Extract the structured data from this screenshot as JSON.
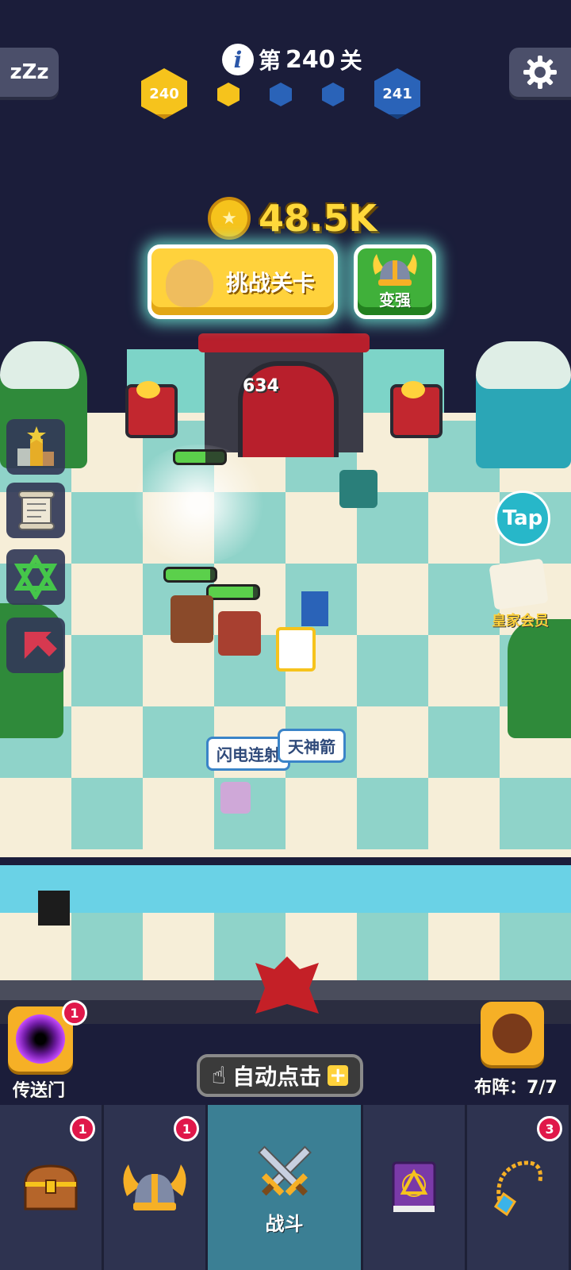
{
  "header": {
    "sleep_label": "zZz",
    "level_prefix": "第",
    "level_number": "240",
    "level_suffix": "关",
    "progress": {
      "current_level": "240",
      "next_level": "241",
      "current_color": "#f6c31c",
      "next_color": "#2a63b8"
    }
  },
  "coins": {
    "value": "48.5K",
    "icon": "coin-icon"
  },
  "actions": {
    "challenge_label": "挑战关卡",
    "upgrade_label": "变强"
  },
  "battle": {
    "damage_number": "634",
    "skill_labels": [
      "闪电连射",
      "天神箭"
    ],
    "enemy_hp": [
      0.62,
      0.9,
      0.9
    ]
  },
  "side_menu": {
    "items": [
      "trophy-icon",
      "scroll-icon",
      "hexagram-icon",
      "arrow-icon"
    ]
  },
  "right": {
    "tap_label": "Tap",
    "vip_label": "皇家会员"
  },
  "bottom": {
    "portal_label": "传送门",
    "portal_badge": "1",
    "auto_click_label": "自动点击",
    "formation_label": "布阵：",
    "formation_value": "7/7"
  },
  "nav": {
    "items": [
      {
        "icon": "treasure-chest-icon",
        "label": "",
        "badge": "1"
      },
      {
        "icon": "viking-helmet-icon",
        "label": "",
        "badge": "1"
      },
      {
        "icon": "crossed-swords-icon",
        "label": "战斗",
        "badge": ""
      },
      {
        "icon": "spellbook-icon",
        "label": "",
        "badge": ""
      },
      {
        "icon": "amulet-icon",
        "label": "",
        "badge": "3"
      }
    ]
  }
}
